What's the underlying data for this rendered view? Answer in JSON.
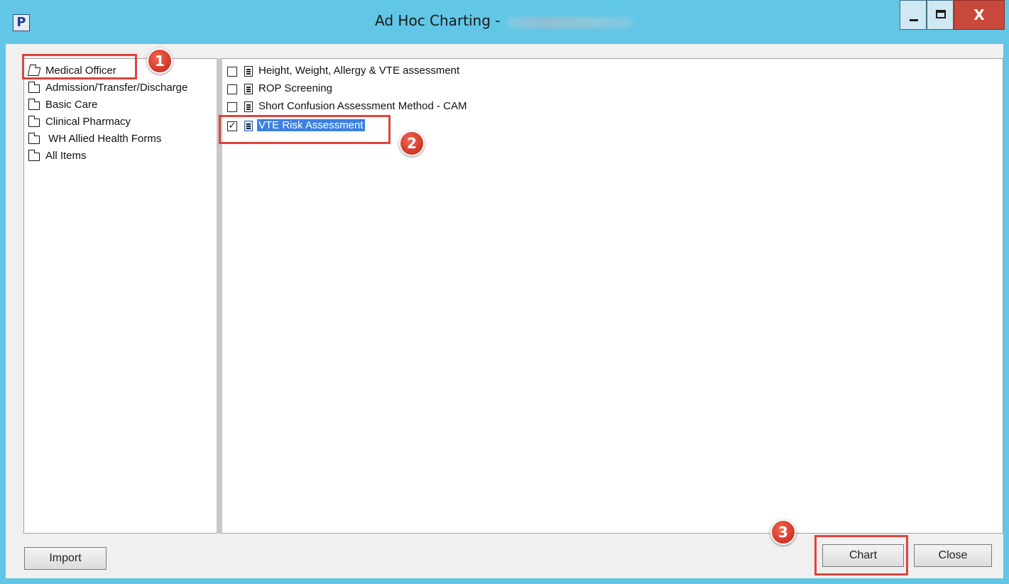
{
  "window": {
    "title": "Ad Hoc Charting -",
    "app_icon_letter": "P",
    "close_glyph": "X"
  },
  "folders": [
    {
      "label": "Medical Officer",
      "icon": "folder-open-icon",
      "selected": true
    },
    {
      "label": "Admission/Transfer/Discharge",
      "icon": "folder-icon"
    },
    {
      "label": "Basic Care",
      "icon": "folder-icon"
    },
    {
      "label": "Clinical Pharmacy",
      "icon": "folder-icon"
    },
    {
      "label": " WH Allied Health Forms",
      "icon": "folder-icon"
    },
    {
      "label": "All Items",
      "icon": "folder-icon"
    }
  ],
  "items": [
    {
      "label": "Height, Weight, Allergy & VTE assessment",
      "checked": false,
      "icon": "document-icon"
    },
    {
      "label": "ROP Screening",
      "checked": false,
      "icon": "document-icon"
    },
    {
      "label": "Short Confusion Assessment Method - CAM",
      "checked": false,
      "icon": "document-icon"
    },
    {
      "label": "VTE Risk Assessment",
      "checked": true,
      "selected": true,
      "icon": "document-icon"
    }
  ],
  "checkbox_glyph": "✓",
  "buttons": {
    "import": "Import",
    "chart": "Chart",
    "close": "Close"
  },
  "callouts": [
    "1",
    "2",
    "3"
  ],
  "colors": {
    "titlebar": "#62c6e6",
    "callout": "#e0443c",
    "selection": "#3b80e2",
    "close_button": "#c9483c"
  }
}
